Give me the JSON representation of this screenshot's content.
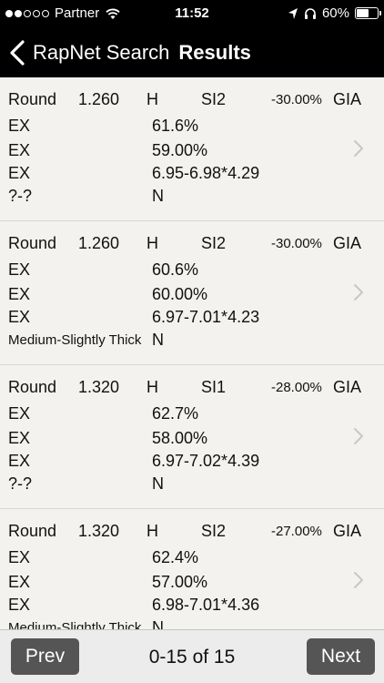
{
  "status_bar": {
    "carrier": "Partner",
    "time": "11:52",
    "battery": "60%",
    "battery_level": 0.6,
    "signal_bars_filled": 2,
    "signal_bars_total": 5
  },
  "nav": {
    "back_label": "RapNet Search",
    "title": "Results"
  },
  "results": [
    {
      "shape": "Round",
      "carat": "1.260",
      "color": "H",
      "clarity": "SI2",
      "discount": "-30.00%",
      "lab": "GIA",
      "cut": "EX",
      "depth": "61.6%",
      "polish": "EX",
      "table": "59.00%",
      "symmetry": "EX",
      "measurements": "6.95-6.98*4.29",
      "girdle": "?-?",
      "fluorescence": "N"
    },
    {
      "shape": "Round",
      "carat": "1.260",
      "color": "H",
      "clarity": "SI2",
      "discount": "-30.00%",
      "lab": "GIA",
      "cut": "EX",
      "depth": "60.6%",
      "polish": "EX",
      "table": "60.00%",
      "symmetry": "EX",
      "measurements": "6.97-7.01*4.23",
      "girdle": "Medium-Slightly Thick",
      "fluorescence": "N"
    },
    {
      "shape": "Round",
      "carat": "1.320",
      "color": "H",
      "clarity": "SI1",
      "discount": "-28.00%",
      "lab": "GIA",
      "cut": "EX",
      "depth": "62.7%",
      "polish": "EX",
      "table": "58.00%",
      "symmetry": "EX",
      "measurements": "6.97-7.02*4.39",
      "girdle": "?-?",
      "fluorescence": "N"
    },
    {
      "shape": "Round",
      "carat": "1.320",
      "color": "H",
      "clarity": "SI2",
      "discount": "-27.00%",
      "lab": "GIA",
      "cut": "EX",
      "depth": "62.4%",
      "polish": "EX",
      "table": "57.00%",
      "symmetry": "EX",
      "measurements": "6.98-7.01*4.36",
      "girdle": "Medium-Slightly Thick",
      "fluorescence": "N"
    }
  ],
  "toolbar": {
    "prev_label": "Prev",
    "page_indicator": "0-15 of 15",
    "next_label": "Next"
  },
  "colors": {
    "bar_background": "#000000",
    "list_background": "#f4f2ee",
    "button_background": "#555555",
    "chevron": "#c7c7cc"
  }
}
